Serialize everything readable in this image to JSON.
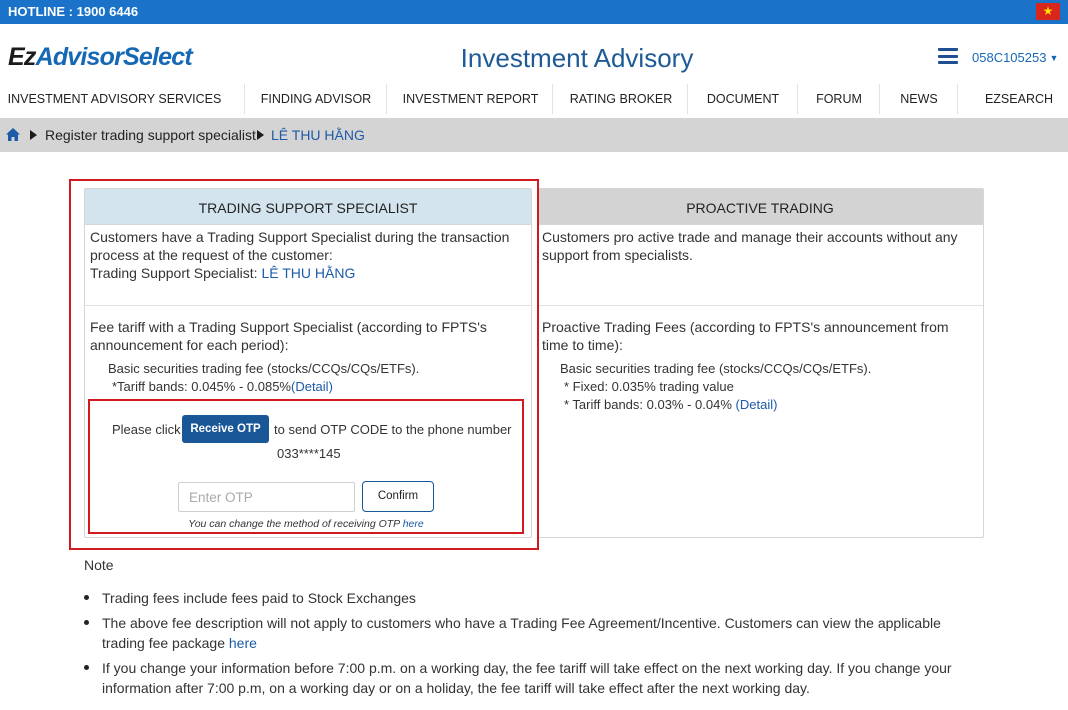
{
  "topbar": {
    "hotline": "HOTLINE : 1900 6446",
    "flag_icon": "vietnam-flag-icon"
  },
  "header": {
    "logo_ez": "Ez",
    "logo_rest": "AdvisorSelect",
    "title": "Investment Advisory",
    "account": "058C105253"
  },
  "nav": {
    "items": [
      "INVESTMENT ADVISORY SERVICES",
      "FINDING ADVISOR",
      "INVESTMENT REPORT",
      "RATING BROKER",
      "DOCUMENT",
      "FORUM",
      "NEWS",
      "EZSEARCH"
    ]
  },
  "breadcrumb": {
    "step1": "Register trading support specialist",
    "step2": "LÊ THU HẰNG"
  },
  "left_card": {
    "title": "TRADING SUPPORT SPECIALIST",
    "desc": "Customers have a Trading Support Specialist during the transaction process at the request of the customer:",
    "specialist_label": "Trading Support Specialist:",
    "specialist_name": "LÊ THU HẰNG",
    "fee_intro": "Fee tariff with a Trading Support Specialist (according to FPTS's announcement for each period):",
    "fee_basic": "Basic securities trading fee (stocks/CCQs/CQs/ETFs).",
    "fee_bands": "*Tariff bands: 0.045% - 0.085%",
    "detail_link": "(Detail)"
  },
  "otp": {
    "text_before": "Please click",
    "button": "Receive OTP",
    "text_after": "to send OTP CODE to the phone number",
    "phone": "033****145",
    "input_placeholder": "Enter OTP",
    "confirm": "Confirm",
    "note": "You can change the method of receiving OTP",
    "note_link": "here"
  },
  "right_card": {
    "title": "PROACTIVE TRADING",
    "desc": "Customers pro active trade and manage their accounts without any support from specialists.",
    "fee_intro": "Proactive Trading Fees (according to FPTS's announcement from time to time):",
    "fee_basic": "Basic securities trading fee (stocks/CCQs/CQs/ETFs).",
    "fee_fixed": "* Fixed: 0.035% trading value",
    "fee_bands": "* Tariff bands: 0.03% - 0.04%",
    "detail_link": "(Detail)"
  },
  "notes": {
    "title": "Note",
    "item1": "Trading fees include fees paid to Stock Exchanges",
    "item2": "The above fee description will not apply to customers who have a Trading Fee Agreement/Incentive. Customers can view the applicable trading fee package",
    "item2_link": "here",
    "item3": "If you change your information before 7:00 p.m. on a working day, the fee tariff will take effect on the next working day. If you change your information after 7:00 p.m, on a working day or on a holiday, the fee tariff will take effect after the next working day."
  },
  "colors": {
    "brand_blue": "#1a73c9",
    "button_navy": "#1a5797",
    "highlight_red": "#d11a1f"
  }
}
